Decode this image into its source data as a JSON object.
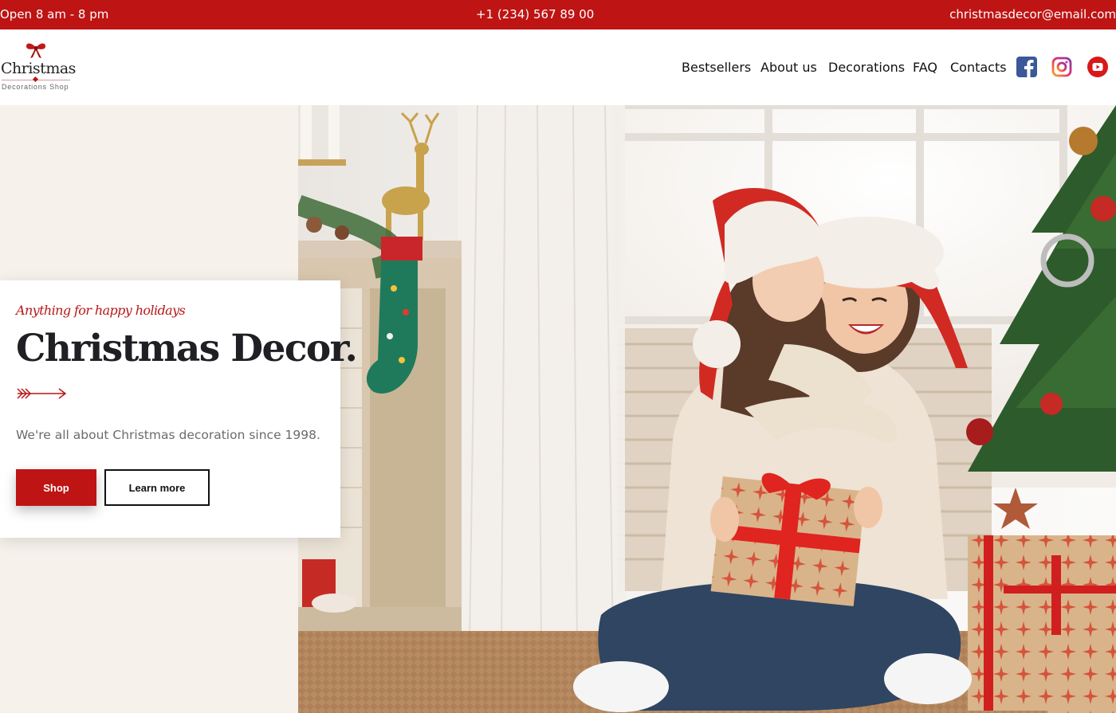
{
  "topbar": {
    "hours": "Open 8 am - 8 pm",
    "phone": "+1 (234) 567 89 00",
    "email": "christmasdecor@email.com"
  },
  "logo": {
    "title": "Christmas",
    "subtitle": "Decorations Shop",
    "icon": "bow-icon"
  },
  "nav": {
    "items": [
      {
        "label": "Bestsellers"
      },
      {
        "label": "About us"
      },
      {
        "label": "Decorations"
      },
      {
        "label": "FAQ"
      },
      {
        "label": "Contacts"
      }
    ]
  },
  "social": [
    {
      "icon": "facebook-icon",
      "color": "#3b5998"
    },
    {
      "icon": "instagram-icon",
      "color": "#d6249f"
    },
    {
      "icon": "youtube-icon",
      "color": "#d81919"
    }
  ],
  "hero": {
    "tagline": "Anything for happy holidays",
    "headline": "Christmas Decor.",
    "description": "We're all about Christmas decoration since 1998.",
    "shop_label": "Shop",
    "learn_label": "Learn more",
    "image_alt": "Mother and daughter in Santa hats with a Christmas gift"
  },
  "colors": {
    "accent": "#be1414",
    "hero_bg": "#f7f1ec",
    "text_dark": "#1f1f24"
  }
}
